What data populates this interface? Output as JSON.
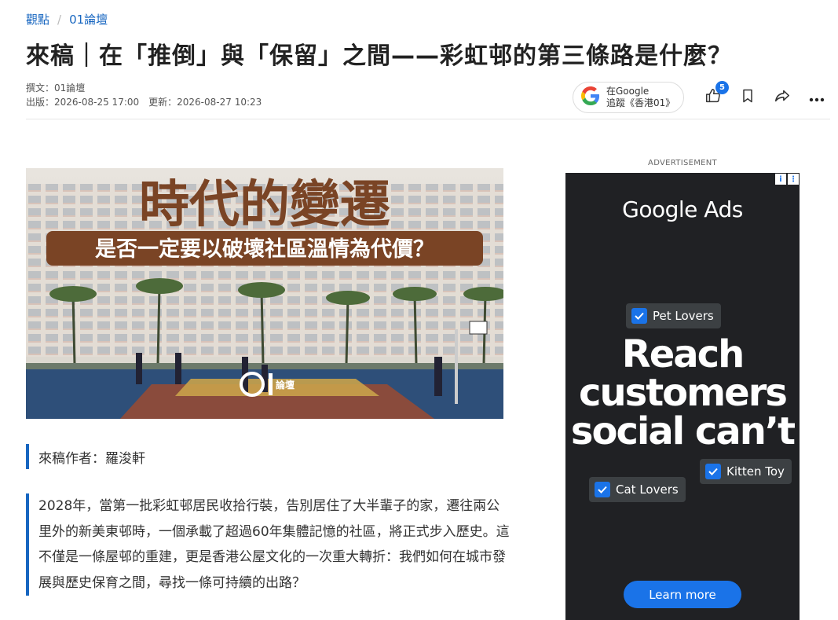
{
  "breadcrumb": {
    "section": "觀點",
    "separator": "/",
    "sub": "01論壇"
  },
  "article": {
    "title": "來稿｜在「推倒」與「保留」之間——彩虹邨的第三條路是什麼？",
    "author_line": "撰文：01論壇",
    "published": "出版：2026-08-25 17:00",
    "updated": "更新：2026-08-27 10:23",
    "hero": {
      "headline": "時代的變遷",
      "subheadline": "是否一定要以破壞社區溫情為代價？",
      "watermark": "論壇",
      "colors": {
        "headline": "#7a4425",
        "banner": "#7a4425",
        "court": "#2e4f79"
      }
    },
    "contributor": "來稿作者：羅浚軒",
    "lead": "2028年，當第一批彩虹邨居民收拾行裝，告別居住了大半輩子的家，遷往兩公里外的新美東邨時，一個承載了超過60年集體記憶的社區，將正式步入歷史。這不僅是一條屋邨的重建，更是香港公屋文化的一次重大轉折：我們如何在城市發展與歷史保育之間，尋找一條可持續的出路？"
  },
  "follow_button": {
    "line1": "在Google",
    "line2": "追蹤《香港01》",
    "icon": "google-g-icon"
  },
  "actions": {
    "like_count": "5",
    "icons": [
      "thumbs-up-icon",
      "bookmark-icon",
      "share-icon",
      "more-icon"
    ]
  },
  "ad": {
    "label": "ADVERTISEMENT",
    "brand": "Google Ads",
    "headline": [
      "Reach",
      "customers",
      "social can’t"
    ],
    "chips": [
      "Pet Lovers",
      "Kitten Toy",
      "Cat Lovers"
    ],
    "cta": "Learn more",
    "colors": {
      "background": "#202124",
      "accent": "#1a73e8"
    }
  },
  "colors": {
    "link": "#1766c0",
    "quote_bar": "#1766c0"
  }
}
